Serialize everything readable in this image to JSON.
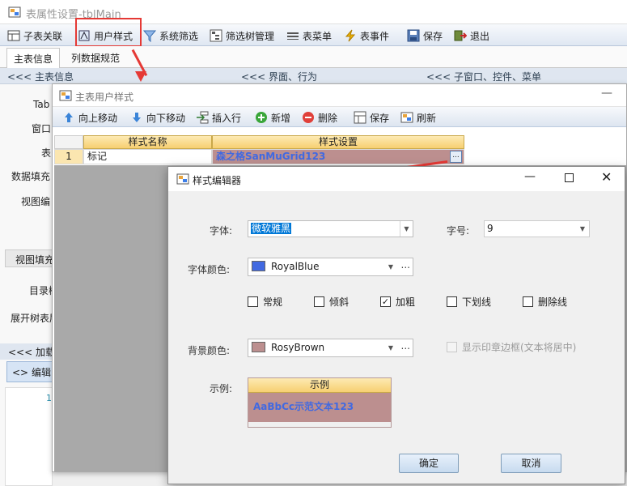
{
  "main_window": {
    "title": "表属性设置-tblMain",
    "toolbar": [
      {
        "label": "子表关联",
        "icon": "table-link-icon"
      },
      {
        "label": "用户样式",
        "icon": "style-icon"
      },
      {
        "label": "系统筛选",
        "icon": "filter-icon"
      },
      {
        "label": "筛选树管理",
        "icon": "tree-icon"
      },
      {
        "label": "表菜单",
        "icon": "menu-icon"
      },
      {
        "label": "表事件",
        "icon": "lightning-icon"
      },
      {
        "label": "保存",
        "icon": "save-icon"
      },
      {
        "label": "退出",
        "icon": "exit-icon"
      }
    ],
    "tabs": [
      "主表信息",
      "列数据规范"
    ],
    "section_headers": [
      "<<< 主表信息",
      "<<< 界面、行为",
      "<<< 子窗口、控件、菜单"
    ],
    "left_labels": [
      "Tab",
      "窗口",
      "表",
      "数据填充",
      "视图编",
      "视图填充",
      "目录树",
      "展开树表层",
      "<<< 加载",
      "编辑",
      "1"
    ],
    "highlight_color": "#e53935"
  },
  "child_window": {
    "title": "主表用户样式",
    "toolbar": [
      {
        "label": "向上移动",
        "icon": "arrow-up-icon"
      },
      {
        "label": "向下移动",
        "icon": "arrow-down-icon"
      },
      {
        "label": "插入行",
        "icon": "insert-row-icon"
      },
      {
        "label": "新增",
        "icon": "add-icon"
      },
      {
        "label": "删除",
        "icon": "delete-icon"
      },
      {
        "label": "保存",
        "icon": "save-icon"
      },
      {
        "label": "刷新",
        "icon": "refresh-icon"
      }
    ],
    "grid": {
      "columns": [
        "样式名称",
        "样式设置"
      ],
      "rows": [
        {
          "index": "1",
          "name": "标记",
          "setting": "森之格SanMuGrid123"
        }
      ]
    }
  },
  "dialog": {
    "title": "样式编辑器",
    "font_label": "字体:",
    "font_value": "微软雅黑",
    "size_label": "字号:",
    "size_value": "9",
    "font_color_label": "字体颜色:",
    "font_color_value": "RoyalBlue",
    "font_color_hex": "#4169e1",
    "styles": [
      {
        "label": "常规",
        "checked": false
      },
      {
        "label": "倾斜",
        "checked": false
      },
      {
        "label": "加粗",
        "checked": true
      },
      {
        "label": "下划线",
        "checked": false
      },
      {
        "label": "删除线",
        "checked": false
      }
    ],
    "bg_color_label": "背景颜色:",
    "bg_color_value": "RosyBrown",
    "bg_color_hex": "#bc8f8f",
    "stamp_border_label": "显示印章边框(文本将居中)",
    "stamp_border_checked": false,
    "example_label": "示例:",
    "example_header": "示例",
    "example_text": "AaBbCc示范文本123",
    "ok_label": "确定",
    "cancel_label": "取消",
    "ellipsis": "..."
  }
}
